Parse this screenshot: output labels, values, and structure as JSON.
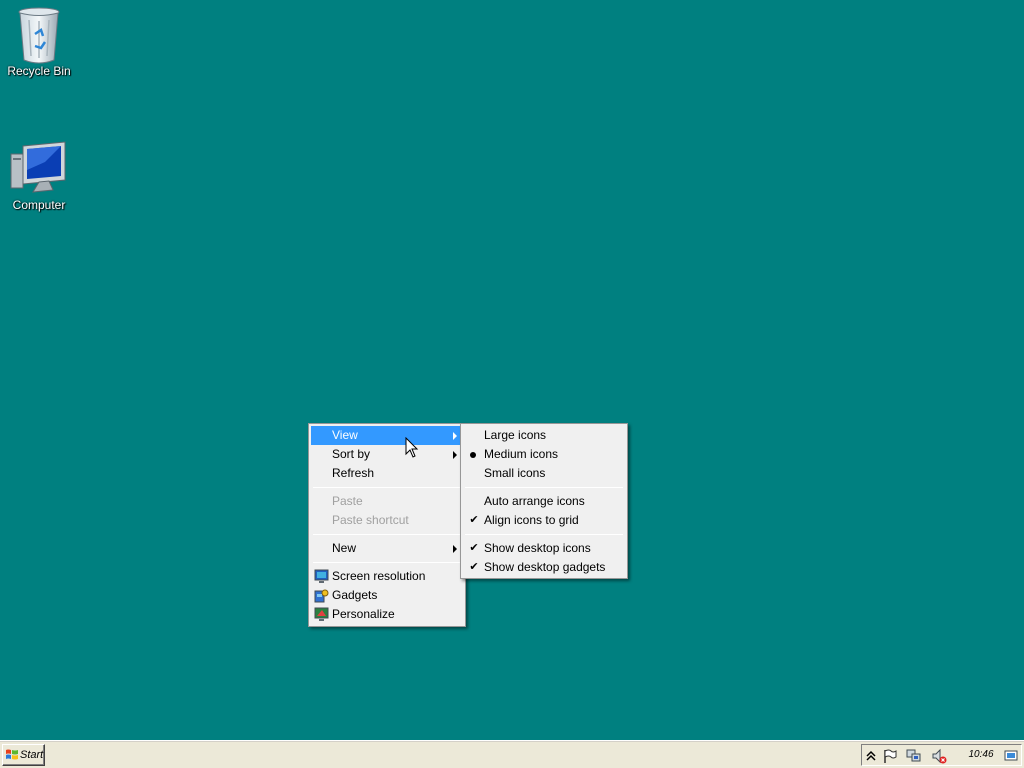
{
  "desktop": {
    "background": "#008080",
    "icons": [
      {
        "label": "Recycle Bin",
        "icon": "recycle-bin-icon"
      },
      {
        "label": "Computer",
        "icon": "computer-icon"
      }
    ]
  },
  "context_menu": {
    "items": [
      {
        "label": "View",
        "submenu": true,
        "highlighted": true
      },
      {
        "label": "Sort by",
        "submenu": true
      },
      {
        "label": "Refresh"
      },
      {
        "label": "Paste",
        "disabled": true
      },
      {
        "label": "Paste shortcut",
        "disabled": true
      },
      {
        "label": "New",
        "submenu": true
      },
      {
        "label": "Screen resolution",
        "icon": "screen-resolution-icon"
      },
      {
        "label": "Gadgets",
        "icon": "gadgets-icon"
      },
      {
        "label": "Personalize",
        "icon": "personalize-icon"
      }
    ],
    "highlight_color": "#3399ff"
  },
  "view_submenu": {
    "items": [
      {
        "label": "Large icons"
      },
      {
        "label": "Medium icons",
        "selected": true
      },
      {
        "label": "Small icons"
      },
      {
        "label": "Auto arrange icons"
      },
      {
        "label": "Align icons to grid",
        "checked": true
      },
      {
        "label": "Show desktop icons",
        "checked": true
      },
      {
        "label": "Show desktop gadgets",
        "checked": true
      }
    ]
  },
  "taskbar": {
    "start_label": "Start",
    "clock": "10:46 PM"
  }
}
